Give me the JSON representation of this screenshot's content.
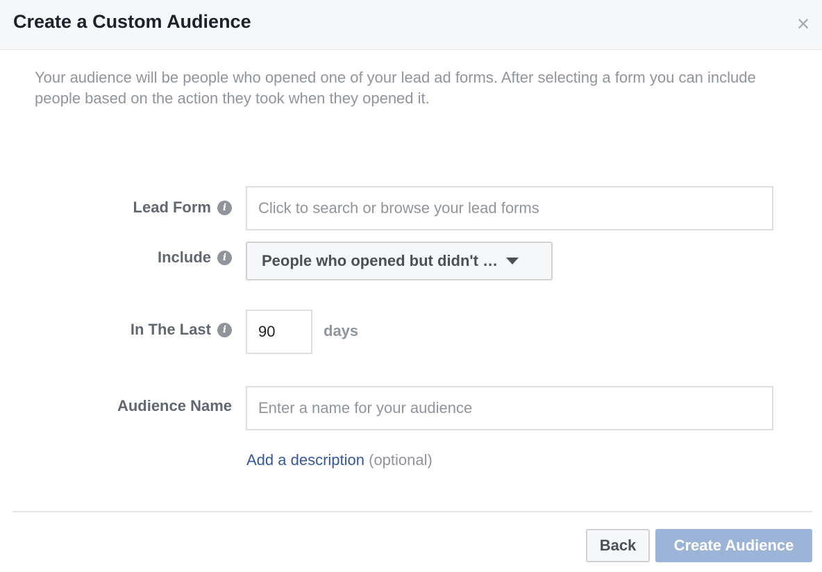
{
  "dialog": {
    "title": "Create a Custom Audience",
    "close_glyph": "×",
    "intro": "Your audience will be people who opened one of your lead ad forms. After selecting a form you can include people based on the action they took when they opened it."
  },
  "form": {
    "lead_form": {
      "label": "Lead Form",
      "info_glyph": "i",
      "placeholder": "Click to search or browse your lead forms",
      "value": ""
    },
    "include": {
      "label": "Include",
      "info_glyph": "i",
      "selected": "People who opened but didn't …"
    },
    "in_the_last": {
      "label": "In The Last",
      "info_glyph": "i",
      "value": "90",
      "unit": "days"
    },
    "audience_name": {
      "label": "Audience Name",
      "placeholder": "Enter a name for your audience",
      "value": ""
    },
    "description": {
      "link_text": "Add a description",
      "suffix": " (optional)"
    }
  },
  "footer": {
    "back_label": "Back",
    "create_label": "Create Audience"
  },
  "colors": {
    "header_bg": "#f6f7f9",
    "link": "#365899",
    "primary_disabled": "#9cb4d8",
    "muted_text": "#90949c"
  }
}
